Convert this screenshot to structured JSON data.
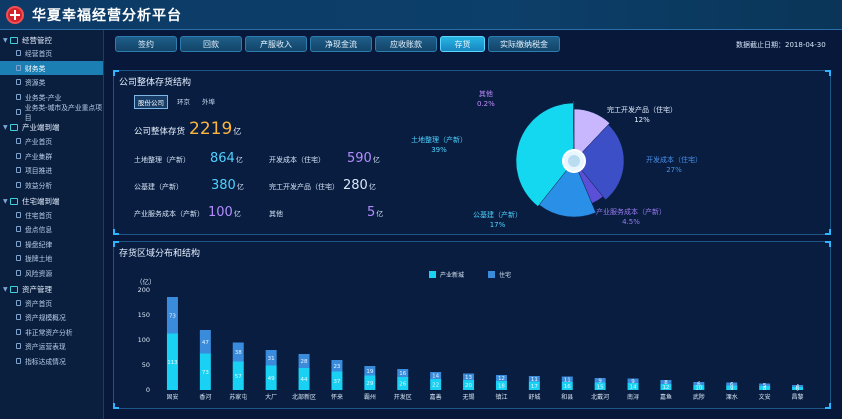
{
  "app": {
    "title": "华夏幸福经营分析平台"
  },
  "sidebar": {
    "groups": [
      {
        "label": "经营管控",
        "items": [
          "经营首页",
          "财务类",
          "资源类",
          "业务类-产业",
          "业务类-城市及产业重点项目"
        ]
      },
      {
        "label": "产业端到端",
        "items": [
          "产业首页",
          "产业集群",
          "项目推进",
          "效益分析"
        ]
      },
      {
        "label": "住宅端到端",
        "items": [
          "住宅首页",
          "盘点信息",
          "操盘纪律",
          "拢牌土地",
          "风险资源"
        ]
      },
      {
        "label": "资产管理",
        "items": [
          "资产首页",
          "资产规模概况",
          "非正常资产分析",
          "资产运营表现",
          "指标达成情况"
        ]
      }
    ],
    "active_item": "财务类"
  },
  "tabs": [
    "签约",
    "回款",
    "产服收入",
    "净现金流",
    "应收账款",
    "存货",
    "实际缴纳税金"
  ],
  "active_tab": "存货",
  "as_of": {
    "label": "数据截止日期：",
    "date": "2018-04-30"
  },
  "panel1": {
    "title": "公司整体存货结构",
    "subtabs": [
      "股份公司",
      "环京",
      "外埠"
    ],
    "total": {
      "label": "公司整体存货",
      "value": "2219",
      "unit": "亿"
    },
    "kpis": [
      {
        "label": "土地整理（产新）",
        "value": "864",
        "unit": "亿"
      },
      {
        "label": "开发成本（住宅）",
        "value": "590",
        "unit": "亿"
      },
      {
        "label": "公基建（产新）",
        "value": "380",
        "unit": "亿"
      },
      {
        "label": "完工开发产品（住宅）",
        "value": "280",
        "unit": "亿"
      },
      {
        "label": "产业服务成本（产新）",
        "value": "100",
        "unit": "亿"
      },
      {
        "label": "其他",
        "value": "5",
        "unit": "亿"
      }
    ],
    "pie_labels": [
      {
        "name": "其他",
        "pct": "0.2%"
      },
      {
        "name": "完工开发产品（住宅）",
        "pct": "12%"
      },
      {
        "name": "土地整理（产新）",
        "pct": "39%"
      },
      {
        "name": "开发成本（住宅）",
        "pct": "27%"
      },
      {
        "name": "公基建（产新）",
        "pct": "17%"
      },
      {
        "name": "产业服务成本（产新）",
        "pct": "4.5%"
      }
    ]
  },
  "panel2": {
    "title": "存货区域分布和结构"
  },
  "colors": {
    "accent": "#1fc4f0",
    "series1": "#18d1f3",
    "series2": "#3a8bdb",
    "kpi_blue": "#4fd2ff",
    "kpi_purple": "#b48cff",
    "gold": "#ffb53c"
  },
  "chart_data": [
    {
      "type": "pie",
      "slices": [
        {
          "name": "土地整理（产新）",
          "value": 39
        },
        {
          "name": "开发成本（住宅）",
          "value": 27
        },
        {
          "name": "公基建（产新）",
          "value": 17
        },
        {
          "name": "完工开发产品（住宅）",
          "value": 12
        },
        {
          "name": "产业服务成本（产新）",
          "value": 4.5
        },
        {
          "name": "其他",
          "value": 0.2
        }
      ]
    },
    {
      "type": "bar",
      "ylabel": "（亿）",
      "ylim": [
        0,
        200
      ],
      "yticks": [
        0,
        50,
        100,
        150,
        200
      ],
      "categories": [
        "固安",
        "香河",
        "苏家屯",
        "大厂",
        "北部新区",
        "怀来",
        "霸州",
        "开发区",
        "嘉善",
        "无锡",
        "镇江",
        "舒城",
        "和县",
        "北戴河",
        "南浔",
        "嘉鱼",
        "武陟",
        "溧水",
        "文安",
        "昌黎"
      ],
      "series": [
        {
          "name": "产业新城",
          "values": [
            113,
            73,
            57,
            49,
            44,
            37,
            29,
            26,
            22,
            20,
            18,
            17,
            16,
            15,
            14,
            12,
            10,
            9,
            8,
            6
          ]
        },
        {
          "name": "住宅",
          "values": [
            73,
            47,
            38,
            31,
            28,
            23,
            19,
            16,
            14,
            13,
            12,
            11,
            11,
            9,
            9,
            8,
            6,
            6,
            5,
            4
          ]
        }
      ]
    }
  ]
}
